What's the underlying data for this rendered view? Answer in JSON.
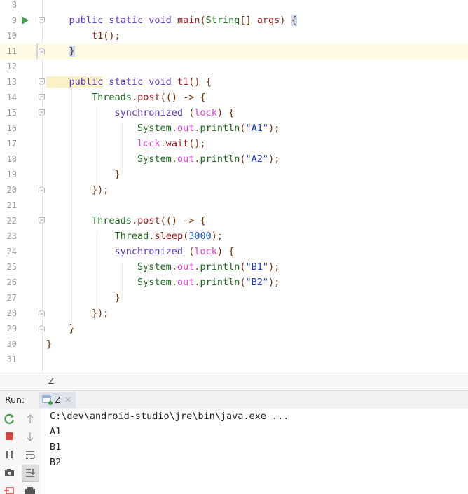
{
  "editor": {
    "lines": [
      {
        "n": "8",
        "tokens": []
      },
      {
        "n": "9",
        "tokens": [
          [
            "k",
            "    public static void "
          ],
          [
            "fn",
            "main"
          ],
          [
            "pn",
            "("
          ],
          [
            "cls",
            "String"
          ],
          [
            "pn",
            "[] "
          ],
          [
            "fn",
            "args"
          ],
          [
            "pn",
            ") "
          ],
          [
            "hlb",
            "{"
          ]
        ]
      },
      {
        "n": "10",
        "tokens": [
          [
            "k",
            "        "
          ],
          [
            "fn",
            "t1"
          ],
          [
            "pn",
            "();"
          ]
        ]
      },
      {
        "n": "11",
        "tokens": [
          [
            "k",
            "    "
          ],
          [
            "hlb",
            "}"
          ]
        ]
      },
      {
        "n": "12",
        "tokens": []
      },
      {
        "n": "13",
        "tokens": [
          [
            "hlk",
            "    public"
          ],
          [
            "k",
            " static void "
          ],
          [
            "fn",
            "t1"
          ],
          [
            "pn",
            "() {"
          ]
        ]
      },
      {
        "n": "14",
        "tokens": [
          [
            "k",
            "        "
          ],
          [
            "cls",
            "Threads"
          ],
          [
            "pn",
            "."
          ],
          [
            "fn",
            "post"
          ],
          [
            "pn",
            "(() -> {"
          ]
        ]
      },
      {
        "n": "15",
        "tokens": [
          [
            "k",
            "            synchronized "
          ],
          [
            "pn",
            "("
          ],
          [
            "fld",
            "lock"
          ],
          [
            "pn",
            ") {"
          ]
        ]
      },
      {
        "n": "16",
        "tokens": [
          [
            "k",
            "                "
          ],
          [
            "cls",
            "System"
          ],
          [
            "pn",
            "."
          ],
          [
            "fld",
            "out"
          ],
          [
            "pn",
            "."
          ],
          [
            "cls",
            "println"
          ],
          [
            "pn",
            "("
          ],
          [
            "str",
            "\"A1\""
          ],
          [
            "pn",
            ");"
          ]
        ]
      },
      {
        "n": "17",
        "tokens": [
          [
            "k",
            "                "
          ],
          [
            "fld",
            "lock"
          ],
          [
            "pn",
            "."
          ],
          [
            "fn",
            "wait"
          ],
          [
            "pn",
            "();"
          ]
        ]
      },
      {
        "n": "18",
        "tokens": [
          [
            "k",
            "                "
          ],
          [
            "cls",
            "System"
          ],
          [
            "pn",
            "."
          ],
          [
            "fld",
            "out"
          ],
          [
            "pn",
            "."
          ],
          [
            "cls",
            "println"
          ],
          [
            "pn",
            "("
          ],
          [
            "str",
            "\"A2\""
          ],
          [
            "pn",
            ");"
          ]
        ]
      },
      {
        "n": "19",
        "tokens": [
          [
            "k",
            "            "
          ],
          [
            "pn",
            "}"
          ]
        ]
      },
      {
        "n": "20",
        "tokens": [
          [
            "k",
            "        "
          ],
          [
            "pn",
            "});"
          ]
        ]
      },
      {
        "n": "21",
        "tokens": []
      },
      {
        "n": "22",
        "tokens": [
          [
            "k",
            "        "
          ],
          [
            "cls",
            "Threads"
          ],
          [
            "pn",
            "."
          ],
          [
            "fn",
            "post"
          ],
          [
            "pn",
            "(() -> {"
          ]
        ]
      },
      {
        "n": "23",
        "tokens": [
          [
            "k",
            "            "
          ],
          [
            "cls",
            "Thread"
          ],
          [
            "pn",
            "."
          ],
          [
            "fn",
            "sleep"
          ],
          [
            "pn",
            "("
          ],
          [
            "num",
            "3000"
          ],
          [
            "pn",
            ");"
          ]
        ]
      },
      {
        "n": "24",
        "tokens": [
          [
            "k",
            "            synchronized "
          ],
          [
            "pn",
            "("
          ],
          [
            "fld",
            "lock"
          ],
          [
            "pn",
            ") {"
          ]
        ]
      },
      {
        "n": "25",
        "tokens": [
          [
            "k",
            "                "
          ],
          [
            "cls",
            "System"
          ],
          [
            "pn",
            "."
          ],
          [
            "fld",
            "out"
          ],
          [
            "pn",
            "."
          ],
          [
            "cls",
            "println"
          ],
          [
            "pn",
            "("
          ],
          [
            "str",
            "\"B1\""
          ],
          [
            "pn",
            ");"
          ]
        ]
      },
      {
        "n": "26",
        "tokens": [
          [
            "k",
            "                "
          ],
          [
            "cls",
            "System"
          ],
          [
            "pn",
            "."
          ],
          [
            "fld",
            "out"
          ],
          [
            "pn",
            "."
          ],
          [
            "cls",
            "println"
          ],
          [
            "pn",
            "("
          ],
          [
            "str",
            "\"B2\""
          ],
          [
            "pn",
            ");"
          ]
        ]
      },
      {
        "n": "27",
        "tokens": [
          [
            "k",
            "            "
          ],
          [
            "pn",
            "}"
          ]
        ]
      },
      {
        "n": "28",
        "tokens": [
          [
            "k",
            "        "
          ],
          [
            "pn",
            "});"
          ]
        ]
      },
      {
        "n": "29",
        "tokens": [
          [
            "k",
            "    "
          ],
          [
            "pn",
            "}"
          ]
        ]
      },
      {
        "n": "30",
        "tokens": [
          [
            "pn",
            "}"
          ]
        ]
      },
      {
        "n": "31",
        "tokens": []
      }
    ],
    "current_line": "11"
  },
  "breadcrumb": {
    "text": "Z"
  },
  "run_panel": {
    "label": "Run:",
    "tab_label": "Z",
    "tab_close": "×",
    "output": [
      "C:\\dev\\android-studio\\jre\\bin\\java.exe ...",
      "A1",
      "B1",
      "B2"
    ]
  },
  "colors": {
    "keyword": "#5a3bc8",
    "class": "#1b6b1b",
    "method": "#a01c1c",
    "field": "#e03ce0",
    "string": "#1a3acc",
    "number": "#1a5ce0",
    "run_green": "#499c54",
    "stop_red": "#d64545"
  },
  "icons": [
    "run-gutter-icon",
    "fold-icon",
    "rerun-icon",
    "stop-icon",
    "pause-icon",
    "camera-icon",
    "exit-icon",
    "up-arrow-icon",
    "down-arrow-icon",
    "soft-wrap-icon",
    "scroll-to-end-icon",
    "print-icon",
    "console-tab-icon"
  ]
}
